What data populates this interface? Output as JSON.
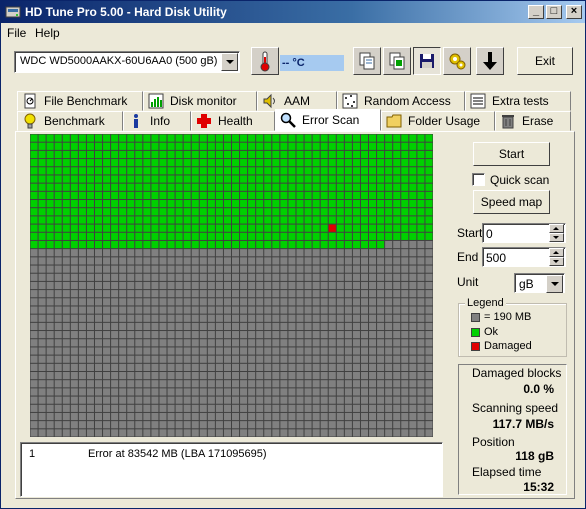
{
  "window": {
    "title": "HD Tune Pro 5.00 - Hard Disk Utility"
  },
  "menu": [
    {
      "label": "File"
    },
    {
      "label": "Help"
    }
  ],
  "toolbar": {
    "drive": "WDC WD5000AAKX-60U6AA0 (500 gB)",
    "temperature": "-- °C",
    "exit_label": "Exit"
  },
  "tabs_top": [
    {
      "label": "File Benchmark",
      "icon": "file-benchmark-icon"
    },
    {
      "label": "Disk monitor",
      "icon": "disk-monitor-icon"
    },
    {
      "label": "AAM",
      "icon": "speaker-icon"
    },
    {
      "label": "Random Access",
      "icon": "random-access-icon"
    },
    {
      "label": "Extra tests",
      "icon": "extra-tests-icon"
    }
  ],
  "tabs_bottom": [
    {
      "label": "Benchmark",
      "icon": "lightbulb-icon"
    },
    {
      "label": "Info",
      "icon": "info-icon"
    },
    {
      "label": "Health",
      "icon": "health-cross-icon"
    },
    {
      "label": "Error Scan",
      "icon": "magnifier-icon",
      "active": true
    },
    {
      "label": "Folder Usage",
      "icon": "folder-icon"
    },
    {
      "label": "Erase",
      "icon": "trash-icon"
    }
  ],
  "scan": {
    "start_button": "Start",
    "quick_scan_label": "Quick scan",
    "quick_scan_checked": false,
    "speed_map_button": "Speed map",
    "start_label": "Start",
    "start_value": "0",
    "end_label": "End",
    "end_value": "500",
    "unit_label": "Unit",
    "unit_value": "gB",
    "grid": {
      "columns": 50,
      "rows": 37,
      "scanned_blocks": 694,
      "damaged_blocks": [
        587
      ],
      "colors": {
        "ok": "#00d000",
        "damaged": "#e00000",
        "unscanned": "#808080",
        "grid": "#404040"
      }
    }
  },
  "legend": {
    "title": "Legend",
    "items": [
      {
        "label": "= 190 MB",
        "color": "#808080"
      },
      {
        "label": "Ok",
        "color": "#00d000"
      },
      {
        "label": "Damaged",
        "color": "#e00000"
      }
    ]
  },
  "stats": {
    "damaged_blocks_label": "Damaged blocks",
    "damaged_blocks_value": "0.0 %",
    "scanning_speed_label": "Scanning speed",
    "scanning_speed_value": "117.7 MB/s",
    "position_label": "Position",
    "position_value": "118 gB",
    "elapsed_label": "Elapsed time",
    "elapsed_value": "15:32"
  },
  "log": [
    {
      "index": "1",
      "message": "Error at 83542 MB (LBA 171095695)"
    }
  ]
}
